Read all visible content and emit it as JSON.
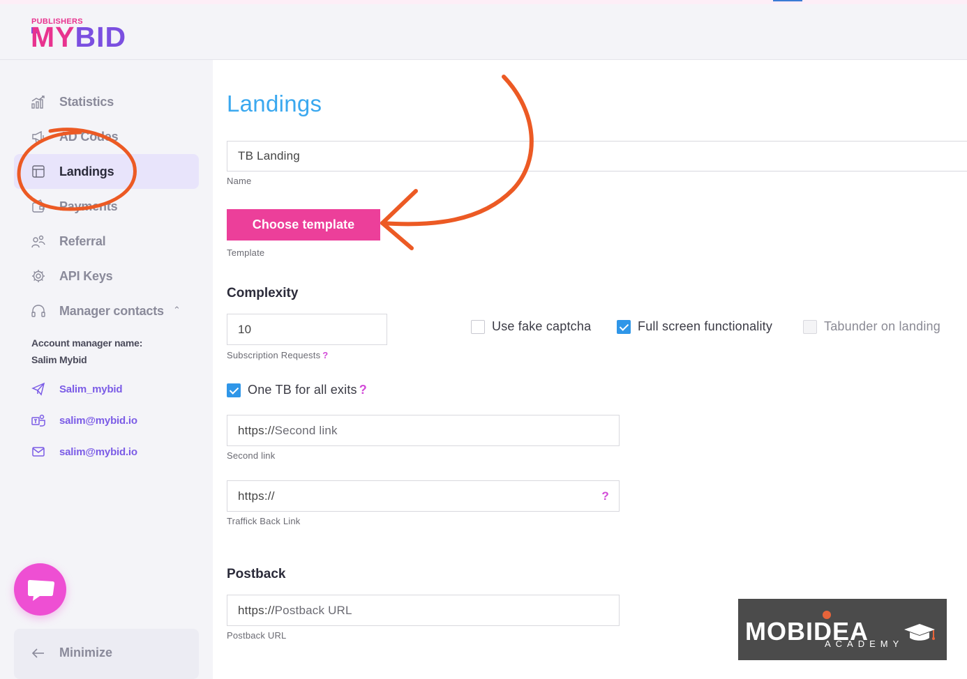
{
  "brand": {
    "small": "PUBLISHERS",
    "my": "MY",
    "bid": "BID",
    "accent_pink": "#e8338f",
    "accent_purple": "#7b4fe0"
  },
  "sidebar": {
    "items": [
      {
        "label": "Statistics",
        "icon": "chart-icon"
      },
      {
        "label": "AD Codes",
        "icon": "megaphone-icon"
      },
      {
        "label": "Landings",
        "icon": "layout-icon",
        "active": true
      },
      {
        "label": "Payments",
        "icon": "wallet-icon"
      },
      {
        "label": "Referral",
        "icon": "referral-icon"
      },
      {
        "label": "API Keys",
        "icon": "gear-icon"
      },
      {
        "label": "Manager contacts",
        "icon": "headset-icon"
      }
    ],
    "account_manager_label": "Account manager name:",
    "account_manager_name": "Salim Mybid",
    "contacts": [
      {
        "label": "Salim_mybid",
        "icon": "telegram-icon"
      },
      {
        "label": "salim@mybid.io",
        "icon": "teams-icon"
      },
      {
        "label": "salim@mybid.io",
        "icon": "mail-icon"
      }
    ],
    "minimize_label": "Minimize"
  },
  "main": {
    "title": "Landings",
    "name_value": "TB Landing",
    "name_caption": "Name",
    "choose_template_label": "Choose template",
    "template_caption": "Template",
    "complexity_title": "Complexity",
    "subscription_value": "10",
    "subscription_caption": "Subscription Requests",
    "help_mark": "?",
    "checkboxes": {
      "fake_captcha": {
        "label": "Use fake captcha",
        "checked": false
      },
      "full_screen": {
        "label": "Full screen functionality",
        "checked": true
      },
      "tabunder": {
        "label": "Tabunder on landing",
        "checked": false,
        "disabled": true
      }
    },
    "one_tb": {
      "label": "One TB for all exits",
      "checked": true
    },
    "second_link_prefix": "https://",
    "second_link_placeholder": "Second link",
    "second_link_caption": "Second link",
    "traffic_back_value": "https://",
    "traffic_back_caption": "Traffick Back Link",
    "postback_title": "Postback",
    "postback_prefix": "https://",
    "postback_placeholder": "Postback URL",
    "postback_caption": "Postback URL"
  },
  "watermark": {
    "text": "MOBIDEA",
    "sub": "ACADEMY"
  }
}
